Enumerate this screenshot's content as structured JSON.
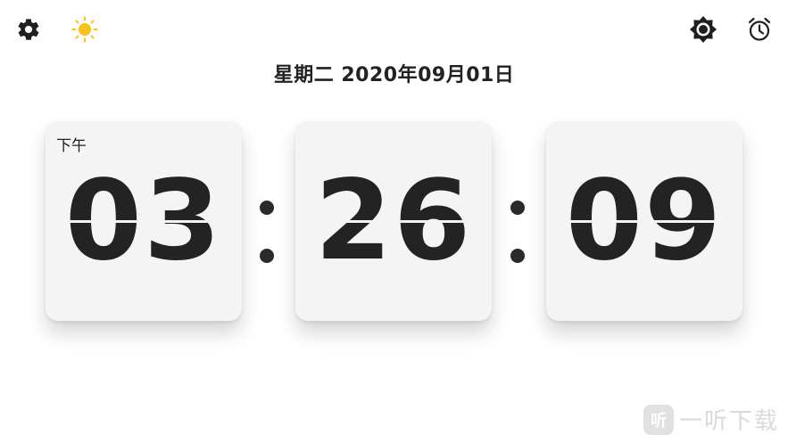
{
  "header": {
    "icons": {
      "settings": "settings-gear-icon",
      "theme": "sun-icon",
      "brightness": "brightness-icon",
      "alarm": "alarm-clock-icon"
    },
    "theme_color": "#F6C21B"
  },
  "date": {
    "text": "星期二  2020年09月01日"
  },
  "clock": {
    "ampm": "下午",
    "hours": "03",
    "minutes": "26",
    "seconds": "09",
    "separator": ":"
  },
  "watermark": {
    "logo_text": "听",
    "text": "一听下载"
  }
}
